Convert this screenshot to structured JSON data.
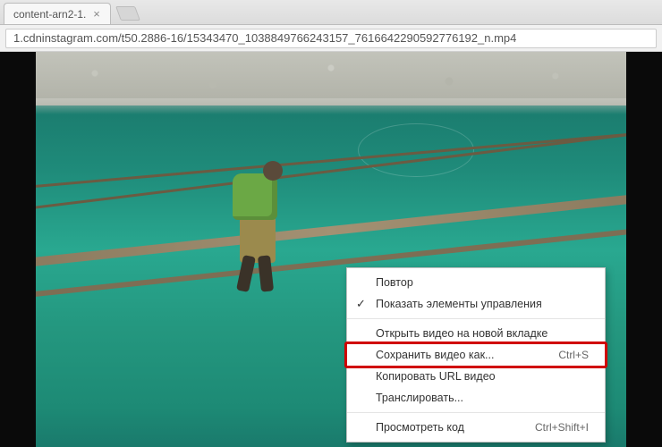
{
  "tab": {
    "title": "content-arn2-1."
  },
  "url": "1.cdninstagram.com/t50.2886-16/15343470_1038849766243157_7616642290592776192_n.mp4",
  "context_menu": {
    "items": [
      {
        "label": "Повтор",
        "checked": false,
        "shortcut": ""
      },
      {
        "label": "Показать элементы управления",
        "checked": true,
        "shortcut": ""
      }
    ],
    "items2": [
      {
        "label": "Открыть видео на новой вкладке",
        "shortcut": ""
      },
      {
        "label": "Сохранить видео как...",
        "shortcut": "Ctrl+S",
        "highlighted": true
      },
      {
        "label": "Копировать URL видео",
        "shortcut": ""
      },
      {
        "label": "Транслировать...",
        "shortcut": ""
      }
    ],
    "items3": [
      {
        "label": "Просмотреть код",
        "shortcut": "Ctrl+Shift+I",
        "shortcut_disabled": true
      }
    ]
  }
}
